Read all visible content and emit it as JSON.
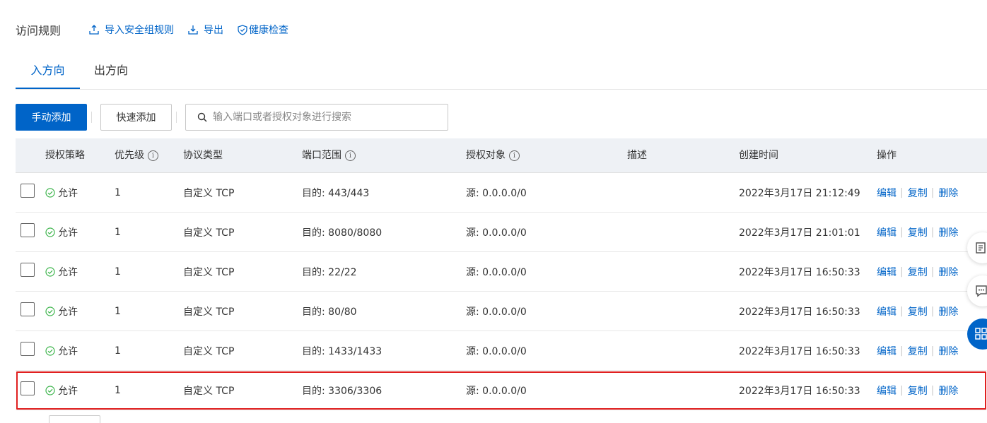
{
  "header": {
    "title": "访问规则",
    "import_label": "导入安全组规则",
    "export_label": "导出",
    "health_label": "健康检查"
  },
  "tabs": [
    {
      "label": "入方向",
      "active": true
    },
    {
      "label": "出方向",
      "active": false
    }
  ],
  "toolbar": {
    "manual_add": "手动添加",
    "quick_add": "快速添加",
    "search_placeholder": "输入端口或者授权对象进行搜索"
  },
  "table": {
    "columns": {
      "policy": "授权策略",
      "priority": "优先级",
      "protocol": "协议类型",
      "port": "端口范围",
      "target": "授权对象",
      "desc": "描述",
      "created": "创建时间",
      "action": "操作"
    },
    "rows": [
      {
        "policy": "允许",
        "priority": "1",
        "protocol": "自定义 TCP",
        "port": "目的: 443/443",
        "target": "源: 0.0.0.0/0",
        "desc": "",
        "created": "2022年3月17日 21:12:49",
        "edit": "编辑",
        "copy": "复制",
        "delete": "删除"
      },
      {
        "policy": "允许",
        "priority": "1",
        "protocol": "自定义 TCP",
        "port": "目的: 8080/8080",
        "target": "源: 0.0.0.0/0",
        "desc": "",
        "created": "2022年3月17日 21:01:01",
        "edit": "编辑",
        "copy": "复制",
        "delete": "删除"
      },
      {
        "policy": "允许",
        "priority": "1",
        "protocol": "自定义 TCP",
        "port": "目的: 22/22",
        "target": "源: 0.0.0.0/0",
        "desc": "",
        "created": "2022年3月17日 16:50:33",
        "edit": "编辑",
        "copy": "复制",
        "delete": "删除"
      },
      {
        "policy": "允许",
        "priority": "1",
        "protocol": "自定义 TCP",
        "port": "目的: 80/80",
        "target": "源: 0.0.0.0/0",
        "desc": "",
        "created": "2022年3月17日 16:50:33",
        "edit": "编辑",
        "copy": "复制",
        "delete": "删除"
      },
      {
        "policy": "允许",
        "priority": "1",
        "protocol": "自定义 TCP",
        "port": "目的: 1433/1433",
        "target": "源: 0.0.0.0/0",
        "desc": "",
        "created": "2022年3月17日 16:50:33",
        "edit": "编辑",
        "copy": "复制",
        "delete": "删除"
      },
      {
        "policy": "允许",
        "priority": "1",
        "protocol": "自定义 TCP",
        "port": "目的: 3306/3306",
        "target": "源: 0.0.0.0/0",
        "desc": "",
        "created": "2022年3月17日 16:50:33",
        "edit": "编辑",
        "copy": "复制",
        "delete": "删除"
      }
    ]
  },
  "colors": {
    "primary": "#0064c8",
    "allow_green": "#3cb44b",
    "highlight_red": "#e02020"
  },
  "icons": {
    "import": "upload-icon",
    "export": "download-icon",
    "health": "shield-check-icon",
    "search": "search-icon",
    "allow": "check-circle-icon",
    "info": "info-icon",
    "float_1": "document-icon",
    "float_2": "feedback-icon",
    "float_3": "apps-icon"
  }
}
